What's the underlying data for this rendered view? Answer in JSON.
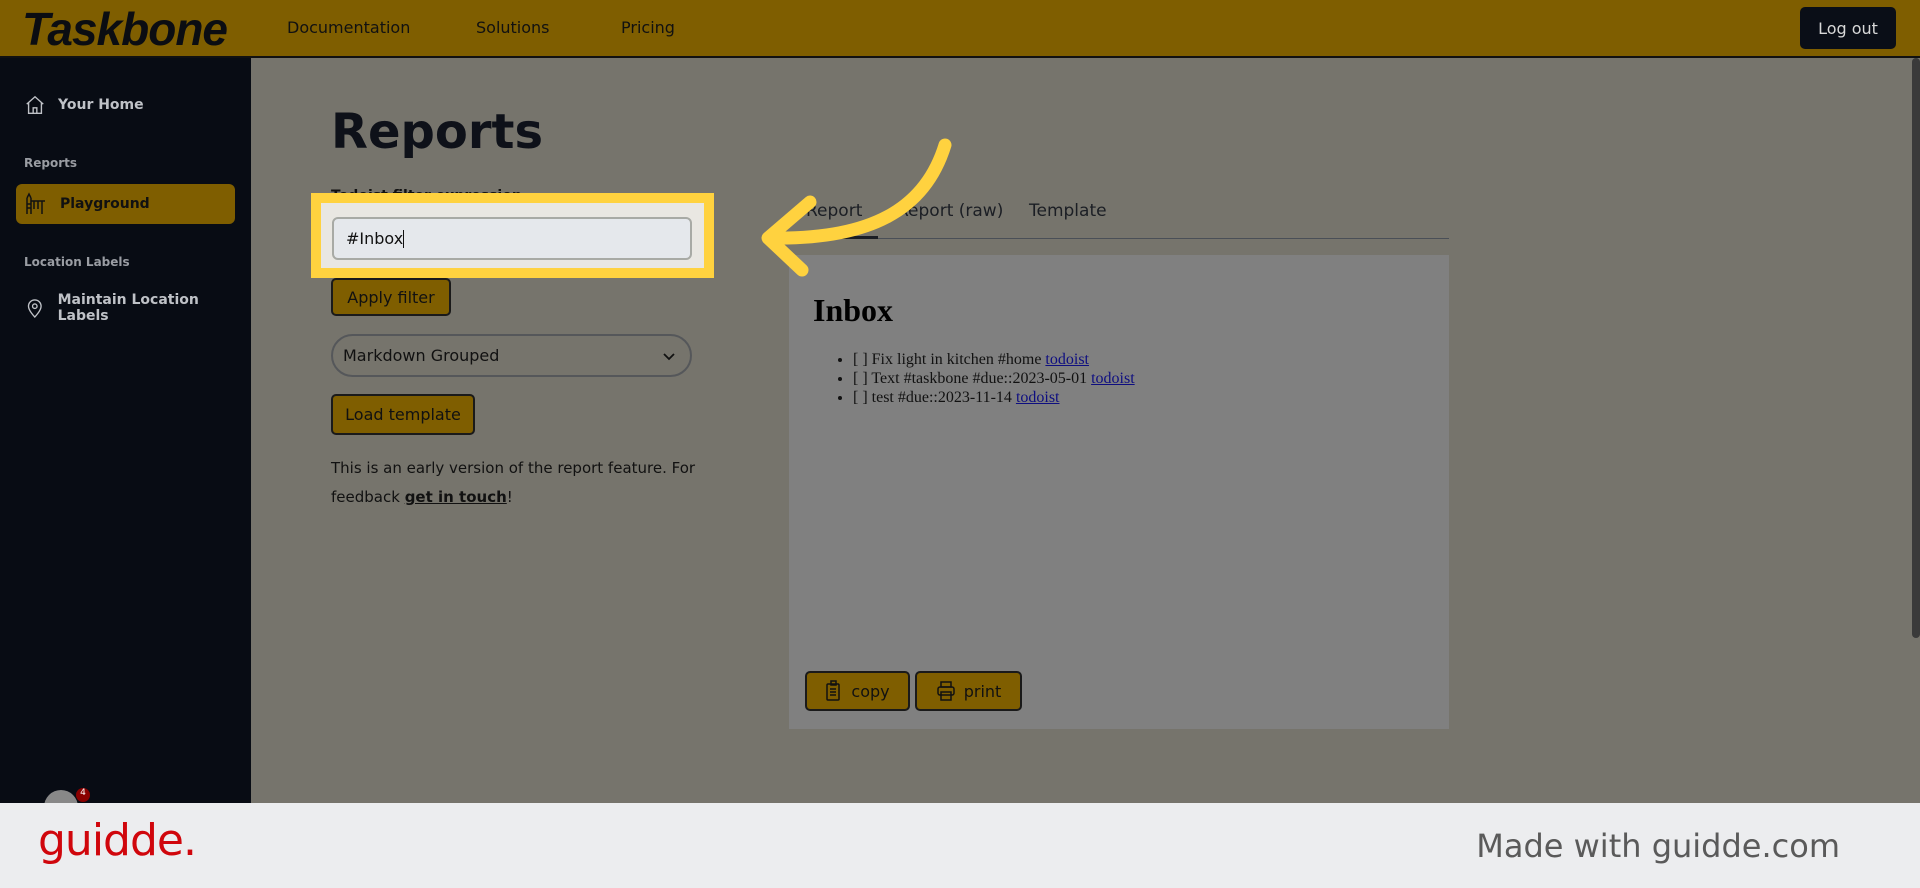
{
  "header": {
    "logo": "Taskbone",
    "nav": [
      "Documentation",
      "Solutions",
      "Pricing"
    ],
    "logout": "Log out"
  },
  "sidebar": {
    "home": "Your Home",
    "section_reports": "Reports",
    "playground": "Playground",
    "section_location": "Location Labels",
    "maintain": "Maintain Location Labels",
    "badge_count": "4"
  },
  "main": {
    "title": "Reports",
    "filter_label": "Todoist filter expression",
    "filter_value": "#Inbox",
    "apply": "Apply filter",
    "select_value": "Markdown Grouped",
    "load": "Load template",
    "note_prefix": "This is an early version of the report feature. For feedback ",
    "note_link": "get in touch",
    "note_suffix": "!"
  },
  "tabs": [
    "Report",
    "Report (raw)",
    "Template"
  ],
  "report": {
    "heading": "Inbox",
    "items": [
      {
        "text": "[ ] Fix light in kitchen #home ",
        "link": "todoist"
      },
      {
        "text": "[ ] Text #taskbone #due::2023-05-01 ",
        "link": "todoist"
      },
      {
        "text": "[ ] test #due::2023-11-14 ",
        "link": "todoist"
      }
    ],
    "copy": "copy",
    "print": "print"
  },
  "footer": {
    "brand": "guidde.",
    "made": "Made with guidde.com"
  },
  "colors": {
    "accent": "#ffd23f",
    "header": "#7f5e00",
    "sidebar": "#080c14"
  }
}
